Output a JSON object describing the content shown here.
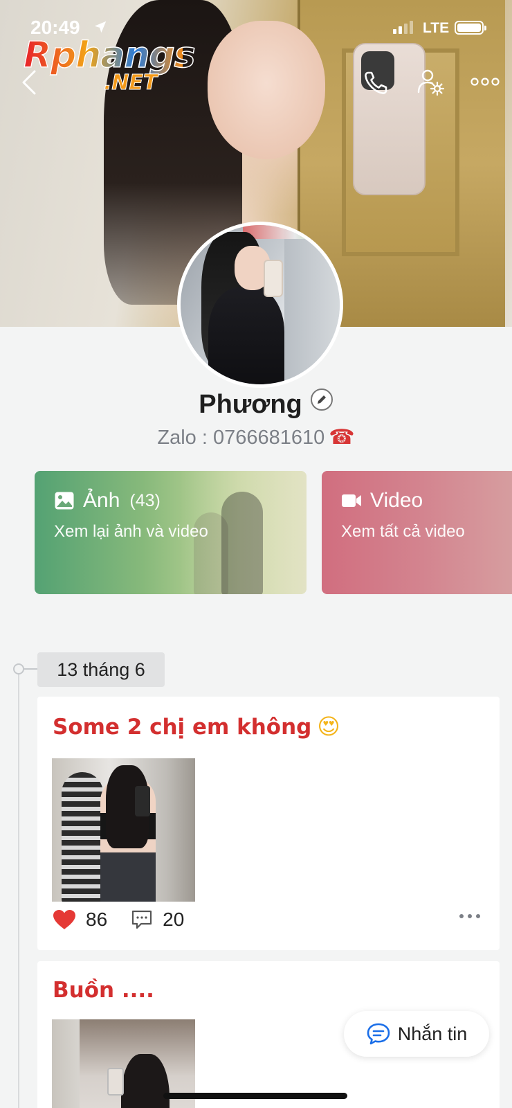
{
  "status_bar": {
    "time": "20:49",
    "network": "LTE",
    "signal_bars_active": 2,
    "signal_bars_total": 4,
    "battery_level": 1.0
  },
  "watermark": {
    "logo_text": "Rphangs",
    "logo_suffix": ".NET"
  },
  "header": {
    "back_icon": "chevron-left-icon",
    "actions": [
      "phone-icon",
      "user-settings-icon",
      "more-horizontal-icon"
    ]
  },
  "profile": {
    "name": "Phương",
    "edit_icon": "pencil-icon",
    "bio": "Zalo : 0766681610",
    "bio_icon_glyph": "☎"
  },
  "media_cards": {
    "photos": {
      "icon": "image-icon",
      "title": "Ảnh",
      "count": "(43)",
      "subtitle": "Xem lại ảnh và video"
    },
    "videos": {
      "icon": "video-camera-icon",
      "title": "Video",
      "subtitle": "Xem tất cả video"
    }
  },
  "timeline": {
    "date_label": "13 tháng 6"
  },
  "posts": [
    {
      "title": "Some 2 chị em không",
      "emoji": "😍",
      "likes": "86",
      "comments": "20"
    },
    {
      "title": "Buồn ...."
    }
  ],
  "message_button": {
    "label": "Nhắn tin",
    "icon": "chat-bubble-icon"
  },
  "colors": {
    "accent_blue": "#1a6ee8",
    "post_title_red": "#d32f2f",
    "like_red": "#e53935",
    "photo_card_green": "#54a273",
    "video_card_pink": "#d16e7f"
  }
}
